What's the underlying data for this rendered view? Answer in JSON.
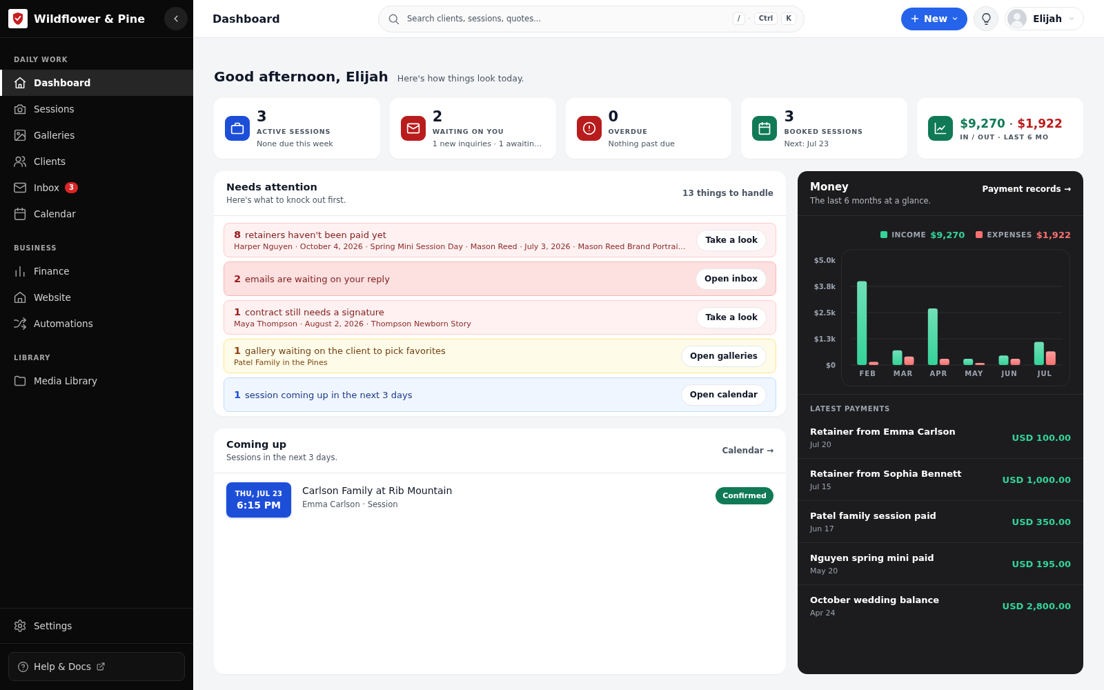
{
  "sidebar": {
    "brand": "Wildflower & Pine",
    "sections": [
      {
        "heading": "DAILY WORK",
        "items": [
          {
            "label": "Dashboard",
            "selected": true
          },
          {
            "label": "Sessions",
            "selected": false
          },
          {
            "label": "Galleries",
            "selected": false
          },
          {
            "label": "Clients",
            "selected": false
          },
          {
            "label": "Inbox",
            "selected": false,
            "badge": "3"
          },
          {
            "label": "Calendar",
            "selected": false
          }
        ]
      },
      {
        "heading": "BUSINESS",
        "items": [
          {
            "label": "Finance",
            "selected": false
          },
          {
            "label": "Website",
            "selected": false
          },
          {
            "label": "Automations",
            "selected": false
          }
        ]
      },
      {
        "heading": "LIBRARY",
        "items": [
          {
            "label": "Media Library",
            "selected": false
          }
        ]
      }
    ],
    "settings": "Settings",
    "help": "Help & Docs"
  },
  "header": {
    "title": "Dashboard",
    "search": {
      "placeholder": "Search clients, sessions, quotes...",
      "shortcut": [
        {
          "kind": "key",
          "label": "/"
        },
        {
          "kind": "separator",
          "label": "·"
        },
        {
          "kind": "key",
          "label": "Ctrl"
        },
        {
          "kind": "key",
          "label": "K"
        }
      ]
    },
    "new_button": "New",
    "user": {
      "name": "Elijah"
    }
  },
  "greeting": {
    "title": "Good afternoon, Elijah",
    "subtitle": "Here's how things look today."
  },
  "stats": [
    {
      "kind": "count",
      "value": "3",
      "label": "ACTIVE SESSIONS",
      "note": "None due this week",
      "color": "#1d4ed8"
    },
    {
      "kind": "count",
      "value": "2",
      "label": "WAITING ON YOU",
      "note": "1 new inquiries · 1 awaitin…",
      "color": "#b91c1c"
    },
    {
      "kind": "count",
      "value": "0",
      "label": "OVERDUE",
      "note": "Nothing past due",
      "color": "#b91c1c"
    },
    {
      "kind": "count",
      "value": "3",
      "label": "BOOKED SESSIONS",
      "note": "Next: Jul 23",
      "color": "#0f7a55"
    },
    {
      "kind": "money",
      "income": "$9,270",
      "separator": "·",
      "expenses": "$1,922",
      "label": "IN / OUT · LAST 6 MO",
      "color": "#0f7a55"
    }
  ],
  "attention": {
    "title": "Needs attention",
    "subtitle": "Here's what to knock out first.",
    "summary": "13 things to handle",
    "items": [
      {
        "kind": "danger",
        "count": "8",
        "title": "retainers haven't been paid yet",
        "detail": "Harper Nguyen · October 4, 2026 · Spring Mini Session Day · Mason Reed · July 3, 2026 · Mason Reed Brand Portrai…",
        "action": "Take a look",
        "highlighted": false
      },
      {
        "kind": "danger",
        "count": "2",
        "title": "emails are waiting on your reply",
        "action": "Open inbox",
        "highlighted": true
      },
      {
        "kind": "danger",
        "count": "1",
        "title": "contract still needs a signature",
        "detail": "Maya Thompson · August 2, 2026 · Thompson Newborn Story",
        "action": "Take a look",
        "highlighted": false
      },
      {
        "kind": "warning",
        "count": "1",
        "title": "gallery waiting on the client to pick favorites",
        "detail": "Patel Family in the Pines",
        "action": "Open galleries",
        "highlighted": false
      },
      {
        "kind": "info",
        "count": "1",
        "title": "session coming up in the next 3 days",
        "action": "Open calendar",
        "highlighted": false
      }
    ]
  },
  "coming_up": {
    "title": "Coming up",
    "subtitle": "Sessions in the next 3 days.",
    "link": "Calendar →",
    "sessions": [
      {
        "day": "THU, JUL 23",
        "time": "6:15 PM",
        "title": "Carlson Family at Rib Mountain",
        "detail": "Emma Carlson · Session",
        "status": "Confirmed"
      }
    ]
  },
  "money": {
    "title": "Money",
    "subtitle": "The last 6 months at a glance.",
    "link": "Payment records →",
    "totals": [
      "$9,270",
      "$1,922"
    ],
    "chart_data": {
      "type": "bar",
      "categories": [
        "FEB",
        "MAR",
        "APR",
        "MAY",
        "JUN",
        "JUL"
      ],
      "series": [
        {
          "name": "INCOME",
          "color": "#34d399",
          "values": [
            4000,
            700,
            2700,
            300,
            450,
            1100
          ]
        },
        {
          "name": "EXPENSES",
          "color": "#f87171",
          "values": [
            150,
            400,
            300,
            100,
            300,
            650
          ]
        }
      ],
      "ylim": [
        0,
        5500
      ],
      "yticks": [
        {
          "value": 0,
          "label": "$0"
        },
        {
          "value": 1250,
          "label": "$1.3k"
        },
        {
          "value": 2500,
          "label": "$2.5k"
        },
        {
          "value": 3750,
          "label": "$3.8k"
        },
        {
          "value": 5000,
          "label": "$5.0k"
        }
      ],
      "grid": true
    },
    "payments_heading": "LATEST PAYMENTS",
    "payments": [
      {
        "title": "Retainer from Emma Carlson",
        "date": "Jul 20",
        "amount": "USD 100.00"
      },
      {
        "title": "Retainer from Sophia Bennett",
        "date": "Jul 15",
        "amount": "USD 1,000.00"
      },
      {
        "title": "Patel family session paid",
        "date": "Jun 17",
        "amount": "USD 350.00"
      },
      {
        "title": "Nguyen spring mini paid",
        "date": "May 20",
        "amount": "USD 195.00"
      },
      {
        "title": "October wedding balance",
        "date": "Apr 24",
        "amount": "USD 2,800.00"
      }
    ]
  }
}
